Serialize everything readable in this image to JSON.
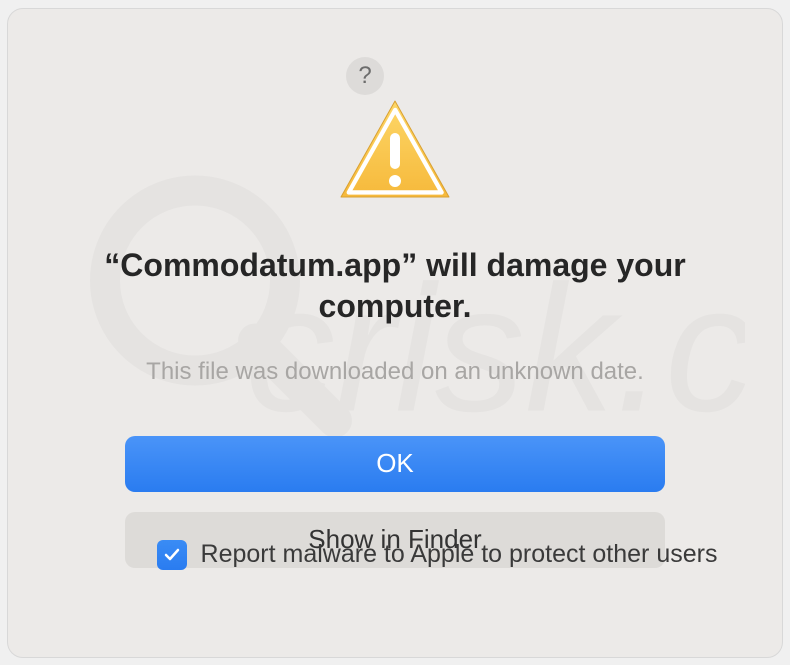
{
  "dialog": {
    "title": "“Commodatum.app” will damage your computer.",
    "subtitle": "This file was downloaded on an unknown date.",
    "primary_button_label": "OK",
    "secondary_button_label": "Show in Finder",
    "checkbox_label": "Report malware to Apple to protect other users",
    "checkbox_checked": true,
    "help_button_label": "?"
  }
}
